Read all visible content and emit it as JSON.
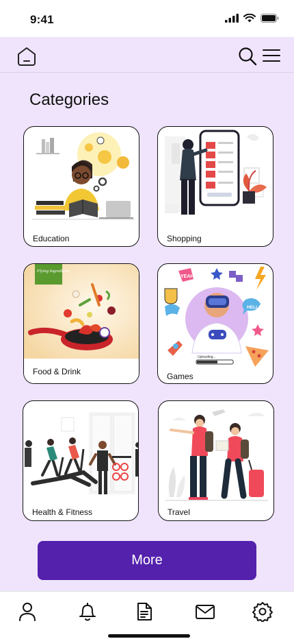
{
  "status": {
    "time": "9:41"
  },
  "page": {
    "title": "Categories"
  },
  "categories": [
    {
      "label": "Education"
    },
    {
      "label": "Shopping"
    },
    {
      "label": "Food & Drink"
    },
    {
      "label": "Games"
    },
    {
      "label": "Health & Fitness"
    },
    {
      "label": "Travel"
    }
  ],
  "illustration_text": {
    "food_badge": "Flying Ingredients",
    "games_speech1": "YEAH!",
    "games_speech2": "HELLO!",
    "games_progress": "Uploading..."
  },
  "more_button": {
    "label": "More"
  },
  "colors": {
    "app_bg": "#efe4fc",
    "accent": "#5421ad"
  },
  "icons": {
    "top": [
      "home-icon",
      "search-icon",
      "menu-icon"
    ],
    "tabs": [
      "profile-icon",
      "bell-icon",
      "document-icon",
      "mail-icon",
      "gear-icon"
    ]
  }
}
